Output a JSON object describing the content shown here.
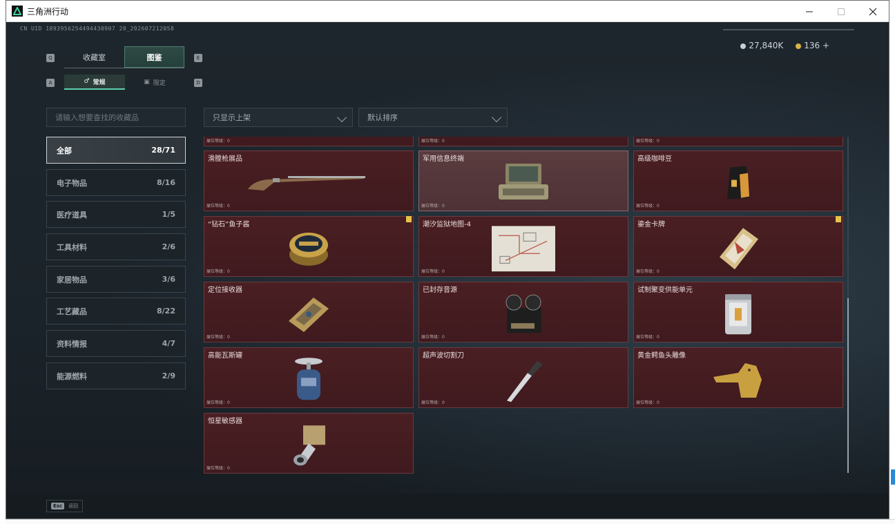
{
  "window": {
    "title": "三角洲行动"
  },
  "header": {
    "uid": "CN UID 1893956254494430907 20_202607212058",
    "currency_a": "27,840K",
    "currency_b": "136 +"
  },
  "tabs": {
    "left_key": "Q",
    "right_key": "E",
    "items": [
      "收藏室",
      "图鉴"
    ]
  },
  "subtabs": {
    "left_key": "A",
    "right_key": "D",
    "items": [
      "常规",
      "限定"
    ]
  },
  "search": {
    "placeholder": "请输入想要查找的收藏品"
  },
  "filters": {
    "filter1": "只显示上架",
    "filter2": "默认排序"
  },
  "categories": [
    {
      "label": "全部",
      "count": "28/71"
    },
    {
      "label": "电子物品",
      "count": "8/16"
    },
    {
      "label": "医疗道具",
      "count": "1/5"
    },
    {
      "label": "工具材料",
      "count": "2/6"
    },
    {
      "label": "家居物品",
      "count": "3/6"
    },
    {
      "label": "工艺藏品",
      "count": "8/22"
    },
    {
      "label": "资料情报",
      "count": "4/7"
    },
    {
      "label": "能源燃料",
      "count": "2/9"
    }
  ],
  "items": [
    {
      "name": "",
      "level": "展位等级：0"
    },
    {
      "name": "",
      "level": "展位等级：0"
    },
    {
      "name": "",
      "level": "展位等级：0"
    },
    {
      "name": "滑膛枪展品",
      "level": "展位等级：0"
    },
    {
      "name": "军用信息终端",
      "level": "展位等级：0"
    },
    {
      "name": "高级咖啡豆",
      "level": "展位等级：0"
    },
    {
      "name": "“钻石”鱼子酱",
      "level": "展位等级：0"
    },
    {
      "name": "潮汐监狱地图-4",
      "level": "展位等级：0"
    },
    {
      "name": "鎏金卡牌",
      "level": "展位等级：0"
    },
    {
      "name": "定位接收器",
      "level": "展位等级：0"
    },
    {
      "name": "已封存音源",
      "level": "展位等级：0"
    },
    {
      "name": "试制聚变供能单元",
      "level": "展位等级：0"
    },
    {
      "name": "高能瓦斯罐",
      "level": "展位等级：0"
    },
    {
      "name": "超声波切割刀",
      "level": "展位等级：0"
    },
    {
      "name": "黄金鳄鱼头雕像",
      "level": "展位等级：0"
    },
    {
      "name": "恒星敏感器",
      "level": "展位等级：0"
    }
  ],
  "footer": {
    "esc_key": "Esc",
    "back_label": "返回"
  },
  "colors": {
    "card_bg": "#4a1f23",
    "accent": "#5fd0b0",
    "badge": "#e7c24a"
  }
}
